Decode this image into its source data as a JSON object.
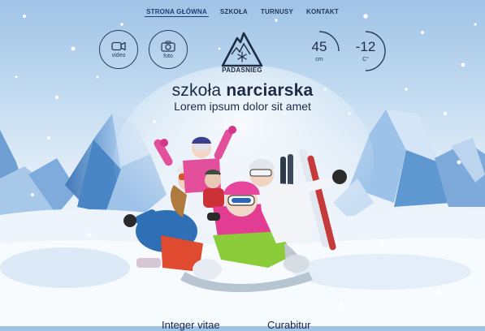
{
  "nav": {
    "items": [
      {
        "label": "STRONA GŁÓWNA",
        "active": true
      },
      {
        "label": "SZKOŁA",
        "active": false
      },
      {
        "label": "TURNUSY",
        "active": false
      },
      {
        "label": "KONTAKT",
        "active": false
      }
    ]
  },
  "media_buttons": {
    "video": {
      "label": "video",
      "icon": "video-camera-icon"
    },
    "foto": {
      "label": "foto",
      "icon": "photo-camera-icon"
    }
  },
  "logo": {
    "text": "PADASNIEG",
    "icon": "snowflake-mountain-icon"
  },
  "weather": {
    "left": {
      "value": "45",
      "unit": "cm"
    },
    "right": {
      "value": "-12",
      "unit": "C°"
    }
  },
  "hero": {
    "title_light": "szkoła ",
    "title_bold": "narciarska",
    "subtitle": "Lorem ipsum dolor sit amet"
  },
  "bottom": {
    "link1": "Integer vitae",
    "link2": "Curabitur"
  },
  "colors": {
    "text": "#1b2b44",
    "sky": "#9fc3e6",
    "mountain": "#5b94cc"
  }
}
